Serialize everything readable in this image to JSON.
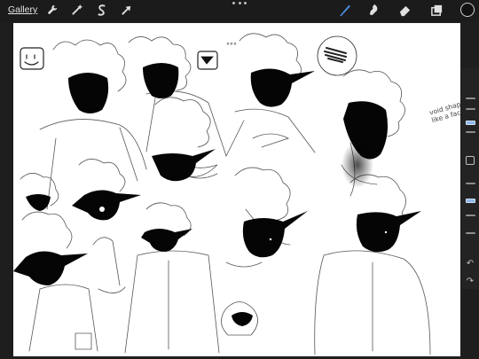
{
  "toolbar": {
    "gallery_label": "Gallery",
    "left_tools": [
      "wrench-icon",
      "magic-wand-icon",
      "selection-s-icon",
      "transform-arrow-icon"
    ],
    "right_tools": [
      "brush-icon",
      "smudge-icon",
      "eraser-icon",
      "layers-icon"
    ],
    "active_tool": "brush-icon",
    "accent_color": "#4a90e2",
    "current_color": "#111111"
  },
  "canvas": {
    "note_text": "void shaped\nlike a face",
    "ellipsis_text": "°°°"
  },
  "sidebar": {
    "undo_glyph": "↶",
    "redo_glyph": "↷",
    "brush_size_slider_value": 0.75,
    "opacity_slider_value": 0.55
  }
}
